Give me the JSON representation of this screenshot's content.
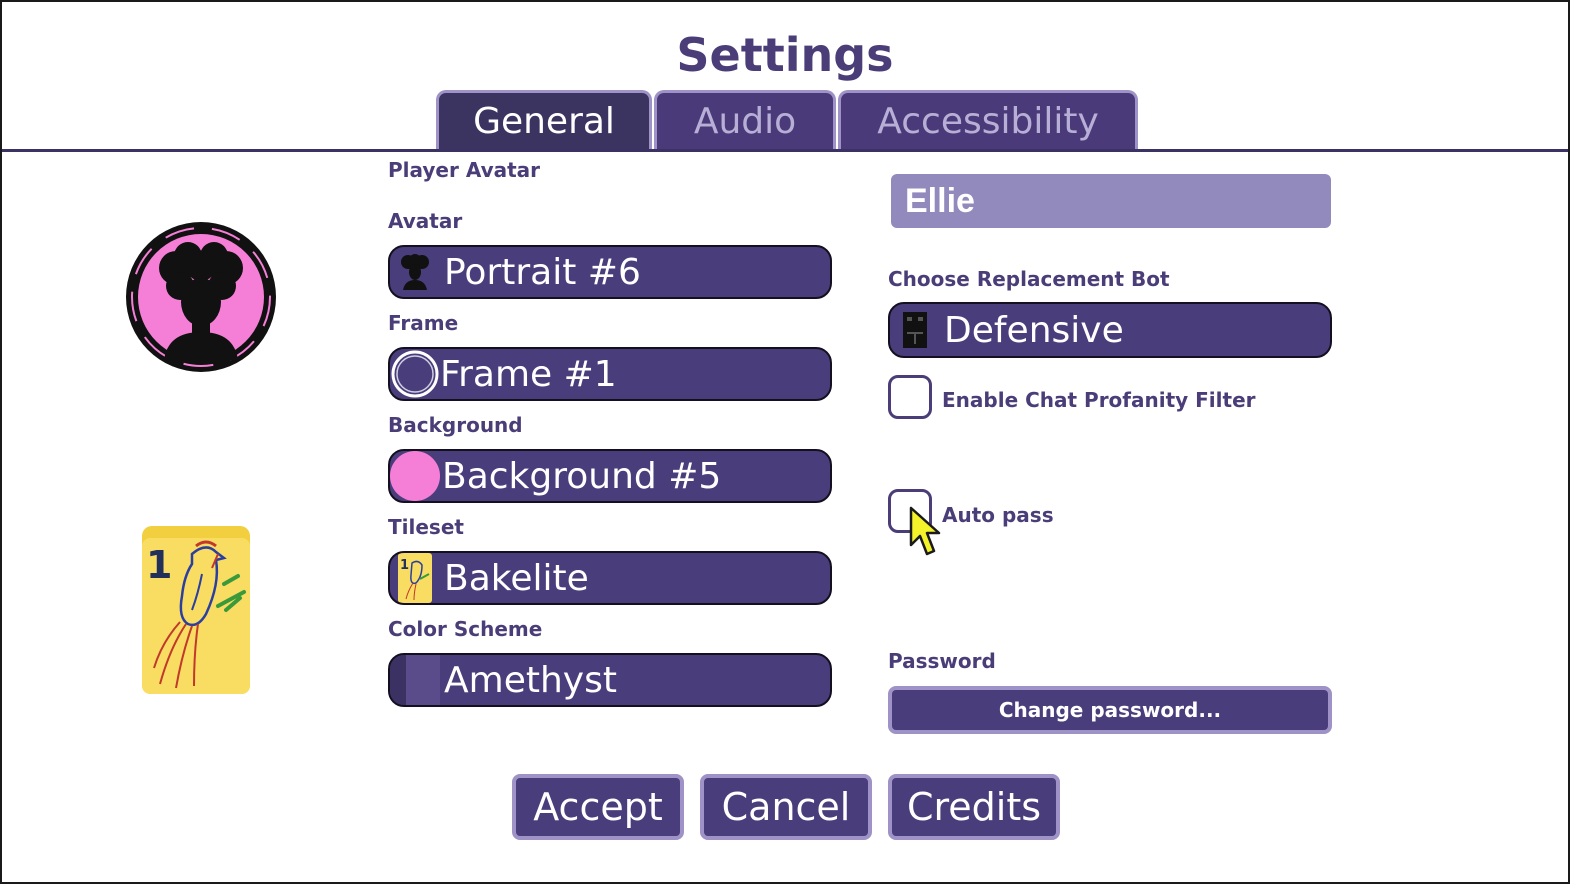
{
  "dialog": {
    "title": "Settings"
  },
  "tabs": [
    {
      "label": "General",
      "active": true
    },
    {
      "label": "Audio",
      "active": false
    },
    {
      "label": "Accessibility",
      "active": false
    }
  ],
  "left": {
    "section_label": "Player Avatar",
    "avatar": {
      "label": "Avatar",
      "value": "Portrait #6",
      "icon": "portrait-silhouette-icon"
    },
    "frame": {
      "label": "Frame",
      "value": "Frame #1",
      "icon": "ring-frame-icon"
    },
    "background": {
      "label": "Background",
      "value": "Background #5",
      "icon": "pink-circle-swatch",
      "color": "#f57fd6"
    },
    "tileset": {
      "label": "Tileset",
      "value": "Bakelite",
      "icon": "bird-tile-icon"
    },
    "color_scheme": {
      "label": "Color Scheme",
      "value": "Amethyst",
      "icon": "color-swatch",
      "color": "#5a4b8a"
    },
    "preview_tile_number": "1"
  },
  "right": {
    "player_name": "Ellie",
    "replacement_bot": {
      "label": "Choose Replacement Bot",
      "value": "Defensive",
      "icon": "bot-icon"
    },
    "profanity_filter": {
      "label": "Enable Chat Profanity Filter",
      "checked": false
    },
    "auto_pass": {
      "label": "Auto pass",
      "checked": false
    },
    "password": {
      "label": "Password",
      "button": "Change password..."
    }
  },
  "footer": {
    "accept": "Accept",
    "cancel": "Cancel",
    "credits": "Credits"
  },
  "colors": {
    "accent": "#4a3d7c",
    "accent_border": "#9e92c6",
    "title_text": "#4a3d78",
    "avatar_pink": "#f57fd6",
    "tile_yellow": "#f9dc62"
  }
}
